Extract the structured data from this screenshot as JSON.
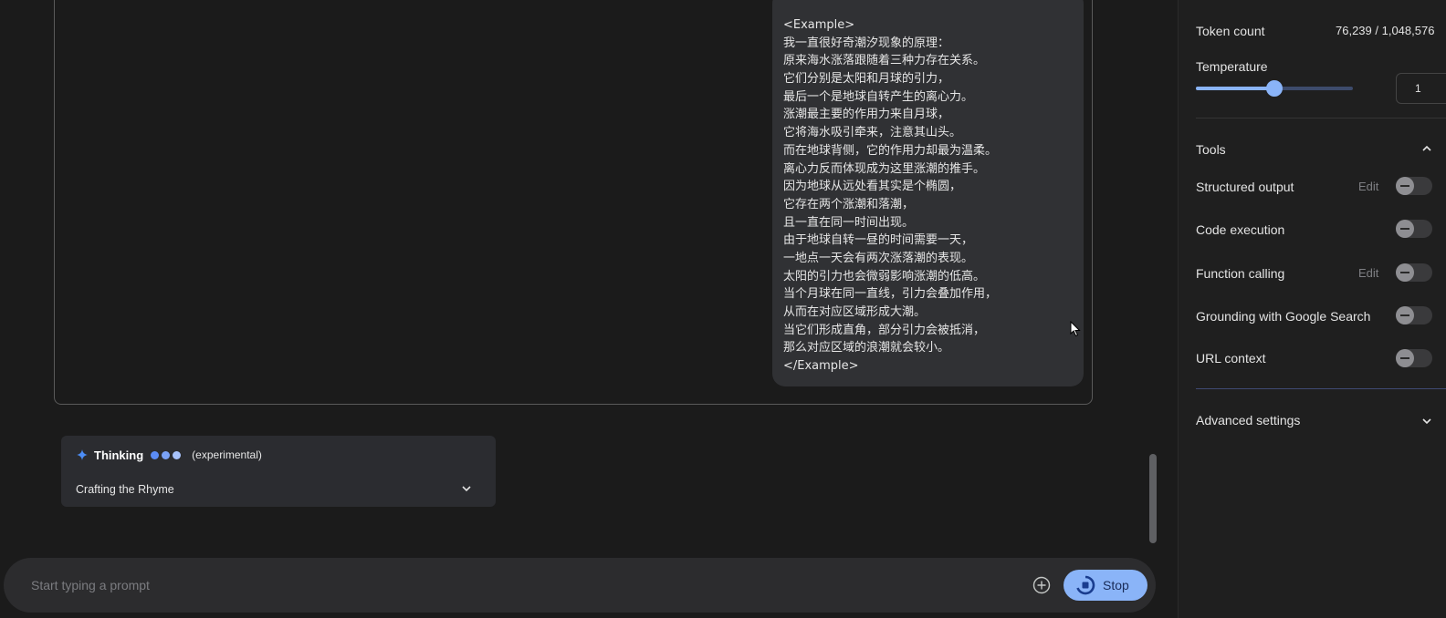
{
  "conversation": {
    "user_message_lines": [
      "<Example>",
      "我一直很好奇潮汐现象的原理：",
      "原来海水涨落跟随着三种力存在关系。",
      "它们分别是太阳和月球的引力，",
      "最后一个是地球自转产生的离心力。",
      "涨潮最主要的作用力来自月球，",
      "它将海水吸引牵来，注意其山头。",
      "而在地球背侧，它的作用力却最为温柔。",
      "离心力反而体现成为这里涨潮的推手。",
      "因为地球从远处看其实是个椭圆，",
      "它存在两个涨潮和落潮，",
      "且一直在同一时间出现。",
      "由于地球自转一昼的时间需要一天，",
      "一地点一天会有两次涨落潮的表现。",
      "太阳的引力也会微弱影响涨潮的低高。",
      "当个月球在同一直线，引力会叠加作用，",
      "从而在对应区域形成大潮。",
      "当它们形成直角，部分引力会被抵消，",
      "那么对应区域的浪潮就会较小。",
      "</Example>"
    ]
  },
  "thinking": {
    "title": "Thinking",
    "tag": "(experimental)",
    "summary": "Crafting the Rhyme"
  },
  "composer": {
    "placeholder": "Start typing a prompt",
    "stop_label": "Stop"
  },
  "settings": {
    "token_count_label": "Token count",
    "token_count_value": "76,239 / 1,048,576",
    "temperature_label": "Temperature",
    "temperature_value": "1",
    "temperature_fraction": 0.5,
    "tools_label": "Tools",
    "tools": [
      {
        "label": "Structured output",
        "edit": "Edit",
        "enabled": false
      },
      {
        "label": "Code execution",
        "edit": "",
        "enabled": false
      },
      {
        "label": "Function calling",
        "edit": "Edit",
        "enabled": false
      },
      {
        "label": "Grounding with Google Search",
        "edit": "",
        "enabled": false
      },
      {
        "label": "URL context",
        "edit": "",
        "enabled": false
      }
    ],
    "advanced_label": "Advanced settings"
  },
  "colors": {
    "accent": "#8ab4f8",
    "background": "#1b1b1b",
    "panel": "#1f1f1f",
    "bubble": "#303134"
  }
}
